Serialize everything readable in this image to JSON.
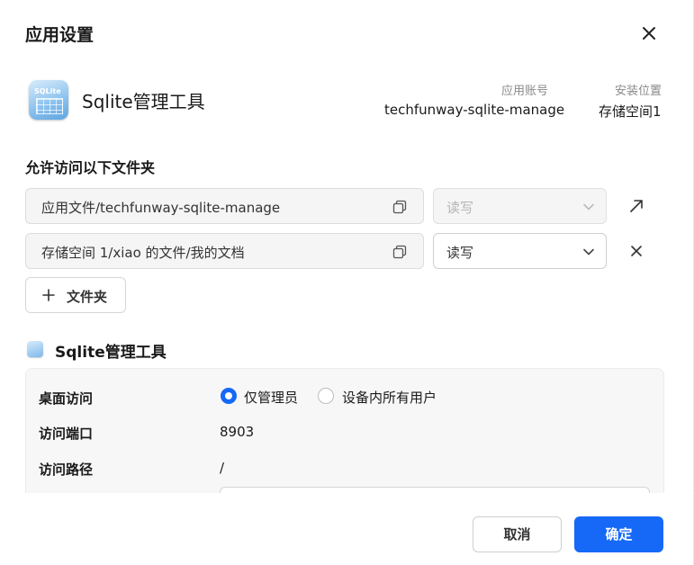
{
  "dialog": {
    "title": "应用设置"
  },
  "app": {
    "name": "Sqlite管理工具",
    "icon": "sqlite-app-icon",
    "icon_text": "SQLite",
    "account_label": "应用账号",
    "account_value": "techfunway-sqlite-manage",
    "location_label": "安装位置",
    "location_value": "存储空间1"
  },
  "folders": {
    "section_title": "允许访问以下文件夹",
    "rows": [
      {
        "path": "应用文件/techfunway-sqlite-manage",
        "permission": "读写",
        "permission_disabled": true,
        "action_icon": "open-arrow-icon"
      },
      {
        "path": "存储空间 1/xiao 的文件/我的文档",
        "permission": "读写",
        "permission_disabled": false,
        "action_icon": "remove-icon"
      }
    ],
    "add_label": "文件夹"
  },
  "app_section": {
    "title": "Sqlite管理工具",
    "desktop_access_label": "桌面访问",
    "desktop_access_options": [
      "仅管理员",
      "设备内所有用户"
    ],
    "desktop_access_selected": "仅管理员",
    "port_label": "访问端口",
    "port_value": "8903",
    "path_label": "访问路径",
    "path_value": "/"
  },
  "footer": {
    "cancel_label": "取消",
    "ok_label": "确定"
  },
  "colors": {
    "accent": "#1669f7"
  }
}
